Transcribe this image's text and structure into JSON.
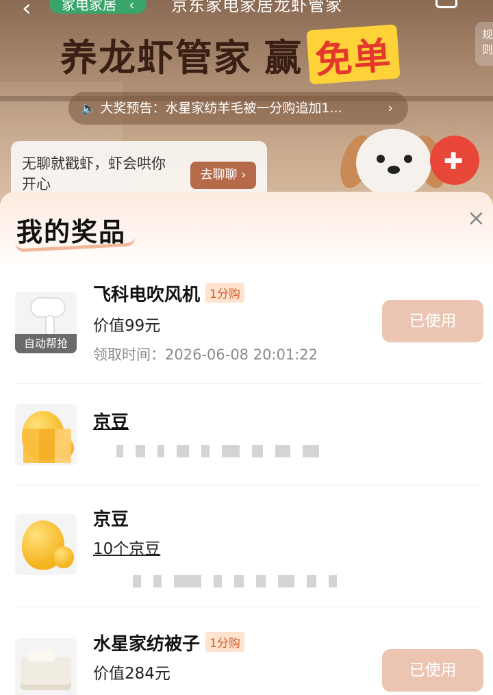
{
  "nav": {
    "back": "‹",
    "category": "家电家居",
    "category_chevron": "‹",
    "title": "京东家电家居龙虾管家",
    "side_tab": "规则"
  },
  "banner": {
    "headline": "养龙虾管家",
    "headline_win": "赢",
    "headline_free": "免单",
    "notice": "大奖预告：水星家纺羊毛被一分购追加1...",
    "notice_chevron": "›",
    "chat_text": "无聊就戳虾，虾会哄你开心",
    "chat_button": "去聊聊 ›"
  },
  "sheet": {
    "title": "我的奖品",
    "close": "×"
  },
  "prizes": [
    {
      "name": "飞科电吹风机",
      "badge": "1分购",
      "value": "价值99元",
      "time_label": "领取时间：",
      "time": "2026-06-08 20:01:22",
      "button": "已使用",
      "thumb_tag": "自动帮抢",
      "icon": "hair-dryer-icon"
    },
    {
      "name": "京豆",
      "icon": "jingdou-icon"
    },
    {
      "name": "京豆",
      "value": "10个京豆",
      "icon": "jingdou-icon"
    },
    {
      "name": "水星家纺被子",
      "badge": "1分购",
      "value": "价值284元",
      "button": "已使用",
      "icon": "quilt-icon"
    }
  ],
  "colors": {
    "accent_green": "#3aa56a",
    "badge_bg": "#ffe3cf",
    "badge_text": "#d45a26",
    "used_button": "#ebc4b2",
    "headline_red": "#e4382d"
  }
}
